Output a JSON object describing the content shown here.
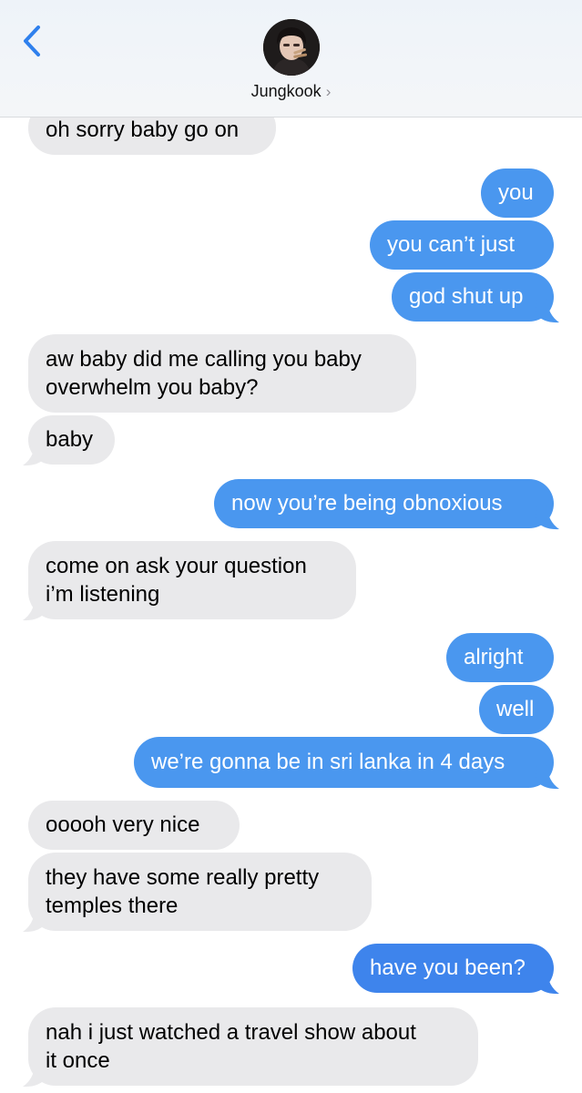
{
  "header": {
    "contact_name": "Jungkook",
    "back_icon": "chevron-left-icon",
    "chevron": "›"
  },
  "colors": {
    "sent_bubble": "#4a97ef",
    "sent_bubble_alt": "#3e84ec",
    "received_bubble": "#e9e9eb",
    "accent": "#2f80ed"
  },
  "messages": [
    {
      "direction": "received",
      "lines": [
        "oh sorry baby go on"
      ]
    },
    {
      "direction": "sent",
      "lines": [
        "you"
      ]
    },
    {
      "direction": "sent",
      "lines": [
        "you can’t just"
      ]
    },
    {
      "direction": "sent",
      "lines": [
        "god shut up"
      ]
    },
    {
      "direction": "received",
      "lines": [
        "aw baby did me calling you baby",
        "overwhelm you baby?"
      ]
    },
    {
      "direction": "received",
      "lines": [
        "baby"
      ]
    },
    {
      "direction": "sent",
      "lines": [
        "now you’re being obnoxious"
      ]
    },
    {
      "direction": "received",
      "lines": [
        "come on ask your question",
        "i’m listening"
      ]
    },
    {
      "direction": "sent",
      "lines": [
        "alright"
      ]
    },
    {
      "direction": "sent",
      "lines": [
        "well"
      ]
    },
    {
      "direction": "sent",
      "lines": [
        "we’re gonna be in sri lanka in 4 days"
      ]
    },
    {
      "direction": "received",
      "lines": [
        "ooooh very nice"
      ]
    },
    {
      "direction": "received",
      "lines": [
        "they have some really pretty",
        "temples there"
      ]
    },
    {
      "direction": "sent",
      "lines": [
        "have you been?"
      ]
    },
    {
      "direction": "received",
      "lines": [
        "nah i just watched a travel show about",
        "it once"
      ]
    }
  ]
}
